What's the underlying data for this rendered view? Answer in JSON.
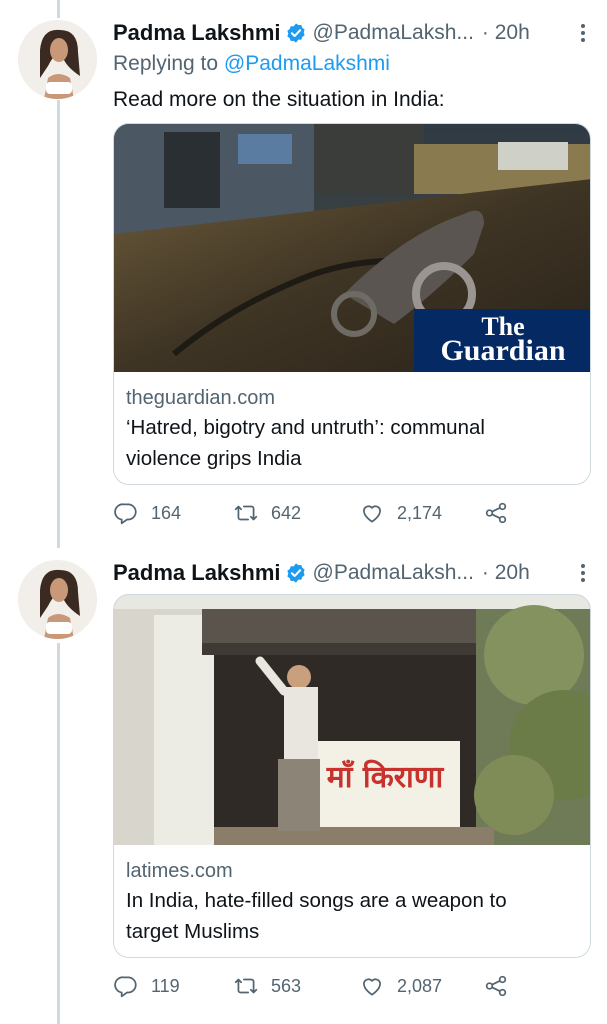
{
  "tweets": [
    {
      "author_name": "Padma Lakshmi",
      "handle": "@PadmaLaksh...",
      "time": "· 20h",
      "replying_prefix": "Replying to ",
      "replying_to": "@PadmaLakshmi",
      "text": "Read more on the situation in India:",
      "card": {
        "image_logo_line1": "The",
        "image_logo_line2": "Guardian",
        "domain": "theguardian.com",
        "title_line1": "‘Hatred, bigotry and untruth’: communal",
        "title_line2": "violence grips India"
      },
      "replies": "164",
      "retweets": "642",
      "likes": "2,174"
    },
    {
      "author_name": "Padma Lakshmi",
      "handle": "@PadmaLaksh...",
      "time": "· 20h",
      "card": {
        "shop_sign_text": "माँ किराणा",
        "domain": "latimes.com",
        "title_line1": "In India, hate-filled songs are a weapon to",
        "title_line2": "target Muslims"
      },
      "replies": "119",
      "retweets": "563",
      "likes": "2,087"
    }
  ],
  "colors": {
    "link_blue": "#1d9bf0",
    "secondary_text": "#536471",
    "border": "#cfd9de",
    "guardian_blue": "#052962"
  },
  "icons": [
    "verified-badge-icon",
    "more-icon",
    "reply-icon",
    "retweet-icon",
    "like-icon",
    "share-icon"
  ]
}
